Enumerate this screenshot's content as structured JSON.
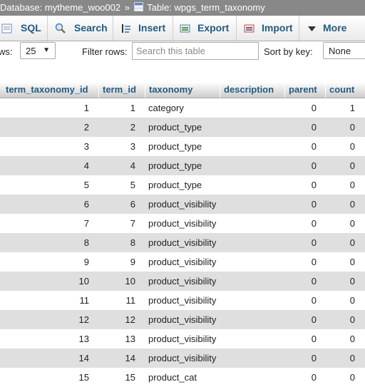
{
  "breadcrumb": {
    "database": "Database: mytheme_woo002",
    "separator": "»",
    "table": "Table: wpgs_term_taxonomy"
  },
  "tabs": [
    {
      "label": "SQL",
      "icon": "sql-icon"
    },
    {
      "label": "Search",
      "icon": "search-icon"
    },
    {
      "label": "Insert",
      "icon": "insert-icon"
    },
    {
      "label": "Export",
      "icon": "export-icon"
    },
    {
      "label": "Import",
      "icon": "import-icon"
    },
    {
      "label": "More",
      "icon": "chevron-down-icon"
    }
  ],
  "toolbar": {
    "rows_label": "ws:",
    "rows_value": "25",
    "filter_label": "Filter rows:",
    "filter_placeholder": "Search this table",
    "sort_label": "Sort by key:",
    "sort_value": "None"
  },
  "table": {
    "columns": [
      "term_taxonomy_id",
      "term_id",
      "taxonomy",
      "description",
      "parent",
      "count"
    ],
    "rows": [
      [
        "1",
        "1",
        "category",
        "",
        "0",
        "1"
      ],
      [
        "2",
        "2",
        "product_type",
        "",
        "0",
        "0"
      ],
      [
        "3",
        "3",
        "product_type",
        "",
        "0",
        "0"
      ],
      [
        "4",
        "4",
        "product_type",
        "",
        "0",
        "0"
      ],
      [
        "5",
        "5",
        "product_type",
        "",
        "0",
        "0"
      ],
      [
        "6",
        "6",
        "product_visibility",
        "",
        "0",
        "0"
      ],
      [
        "7",
        "7",
        "product_visibility",
        "",
        "0",
        "0"
      ],
      [
        "8",
        "8",
        "product_visibility",
        "",
        "0",
        "0"
      ],
      [
        "9",
        "9",
        "product_visibility",
        "",
        "0",
        "0"
      ],
      [
        "10",
        "10",
        "product_visibility",
        "",
        "0",
        "0"
      ],
      [
        "11",
        "11",
        "product_visibility",
        "",
        "0",
        "0"
      ],
      [
        "12",
        "12",
        "product_visibility",
        "",
        "0",
        "0"
      ],
      [
        "13",
        "13",
        "product_visibility",
        "",
        "0",
        "0"
      ],
      [
        "14",
        "14",
        "product_visibility",
        "",
        "0",
        "0"
      ],
      [
        "15",
        "15",
        "product_cat",
        "",
        "0",
        "0"
      ]
    ]
  },
  "colors": {
    "topbar": "#888888",
    "link": "#235a81",
    "row_alt": "#dfdfdf"
  }
}
